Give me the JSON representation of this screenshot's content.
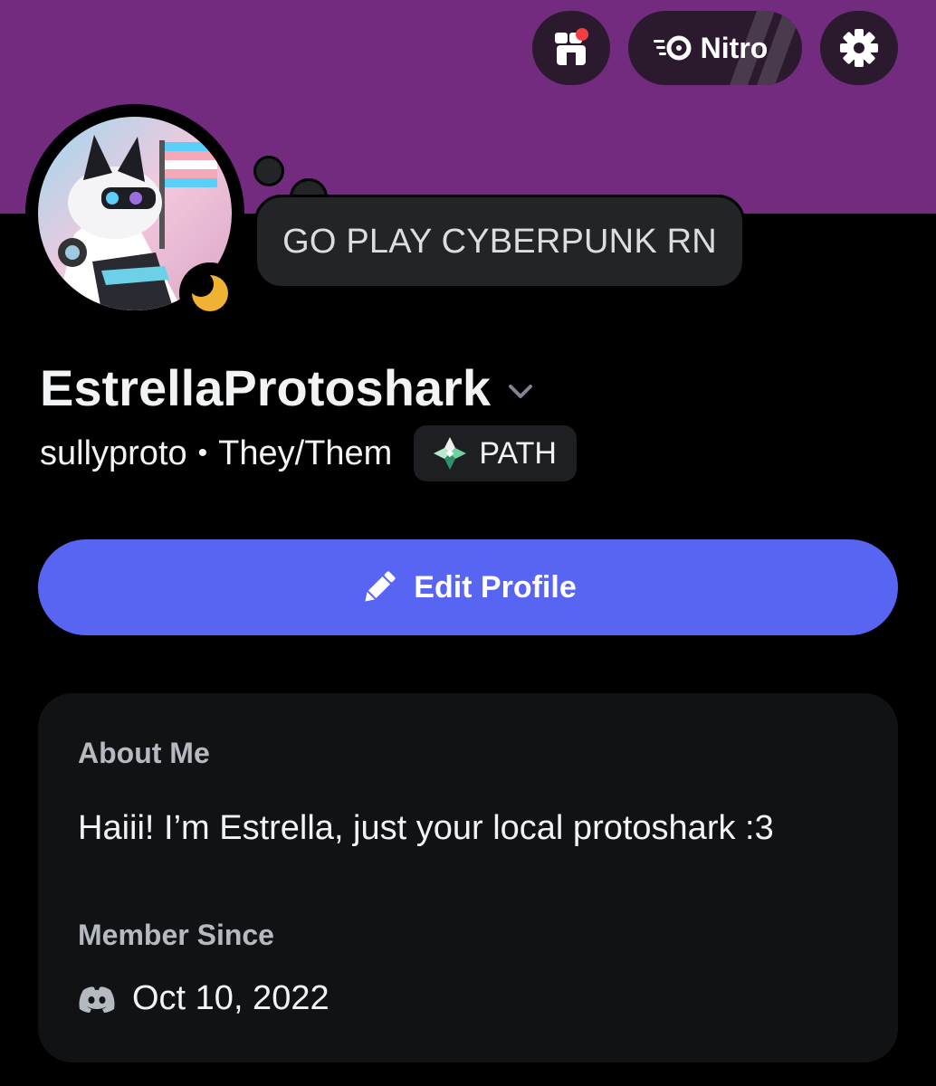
{
  "colors": {
    "banner": "#732b7f",
    "background": "#000000",
    "accent_button": "#5865f2",
    "card": "#111214",
    "status_idle": "#f0b232",
    "notification_dot": "#f23f43"
  },
  "header": {
    "shop_icon": "shop-icon",
    "nitro_label": "Nitro",
    "nitro_icon": "nitro-icon",
    "settings_icon": "gear-icon"
  },
  "profile": {
    "status_text": "GO PLAY CYBERPUNK RN",
    "presence": "idle",
    "display_name": "EstrellaProtoshark",
    "username": "sullyproto",
    "separator": "•",
    "pronouns": "They/Them",
    "tag": "PATH"
  },
  "actions": {
    "edit_label": "Edit Profile"
  },
  "about": {
    "heading": "About Me",
    "text": "Haiii! I’m Estrella, just your local protoshark :3"
  },
  "member": {
    "heading": "Member Since",
    "date": "Oct 10, 2022"
  }
}
